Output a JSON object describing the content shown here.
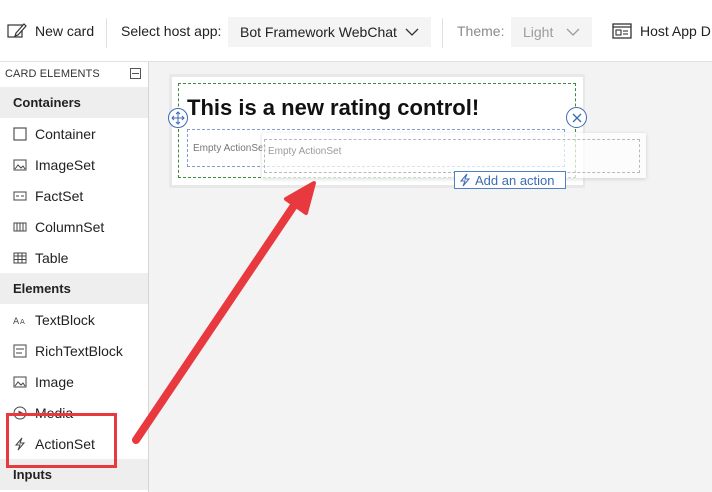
{
  "toolbar": {
    "new_card": "New card",
    "host_label": "Select host app:",
    "host_value": "Bot Framework WebChat",
    "theme_label": "Theme:",
    "theme_value": "Light",
    "host_app_button": "Host App D"
  },
  "sidebar": {
    "header": "CARD ELEMENTS",
    "categories": {
      "containers": "Containers",
      "elements": "Elements",
      "inputs": "Inputs"
    },
    "items": [
      {
        "label": "Container",
        "icon": "container-icon"
      },
      {
        "label": "ImageSet",
        "icon": "imageset-icon"
      },
      {
        "label": "FactSet",
        "icon": "factset-icon"
      },
      {
        "label": "ColumnSet",
        "icon": "columnset-icon"
      },
      {
        "label": "Table",
        "icon": "table-icon"
      },
      {
        "label": "TextBlock",
        "icon": "textblock-icon"
      },
      {
        "label": "RichTextBlock",
        "icon": "richtextblock-icon"
      },
      {
        "label": "Image",
        "icon": "image-icon"
      },
      {
        "label": "Media",
        "icon": "media-icon"
      },
      {
        "label": "ActionSet",
        "icon": "actionset-icon"
      }
    ]
  },
  "canvas": {
    "title": "This is a new rating control!",
    "empty_actionset_label": "Empty ActionSet",
    "ghost_label": "Empty ActionSet",
    "add_action": "Add an action"
  },
  "colors": {
    "highlight": "#e8393f",
    "arrow": "#e8393f",
    "accent": "#3d6bb3",
    "selection_green": "#3c8a3c"
  }
}
